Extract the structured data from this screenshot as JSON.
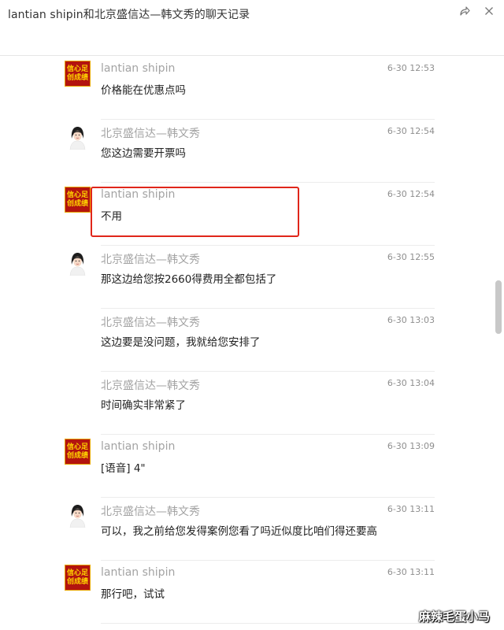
{
  "window": {
    "title": "lantian shipin和北京盛信达—韩文秀的聊天记录"
  },
  "messages": [
    {
      "sender": "lantian shipin",
      "time": "6-30 12:53",
      "text": "价格能在优惠点吗",
      "avatar": "brand-logo"
    },
    {
      "sender": "北京盛信达—韩文秀",
      "time": "6-30 12:54",
      "text": "您这边需要开票吗",
      "avatar": "woman-portrait"
    },
    {
      "sender": "lantian shipin",
      "time": "6-30 12:54",
      "text": "不用",
      "avatar": "brand-logo"
    },
    {
      "sender": "北京盛信达—韩文秀",
      "time": "6-30 12:55",
      "text": "那这边给您按2660得费用全都包括了",
      "avatar": "woman-portrait",
      "highlighted": true
    },
    {
      "sender": "北京盛信达—韩文秀",
      "time": "6-30 13:03",
      "text": "这边要是没问题，我就给您安排了",
      "avatar": ""
    },
    {
      "sender": "北京盛信达—韩文秀",
      "time": "6-30 13:04",
      "text": "时间确实非常紧了",
      "avatar": ""
    },
    {
      "sender": "lantian shipin",
      "time": "6-30 13:09",
      "text": "[语音] 4\"",
      "avatar": "brand-logo"
    },
    {
      "sender": "北京盛信达—韩文秀",
      "time": "6-30 13:11",
      "text": "可以，我之前给您发得案例您看了吗近似度比咱们得还要高",
      "avatar": "woman-portrait"
    },
    {
      "sender": "lantian shipin",
      "time": "6-30 13:11",
      "text": "那行吧，试试",
      "avatar": "brand-logo"
    }
  ],
  "brand_logo_text": [
    "信心足",
    "创成绩"
  ],
  "watermark": "麻辣毛蛋小马",
  "colors": {
    "highlight": "#e0261a",
    "logo_bg": "#b3140f",
    "logo_text": "#ffd400"
  }
}
